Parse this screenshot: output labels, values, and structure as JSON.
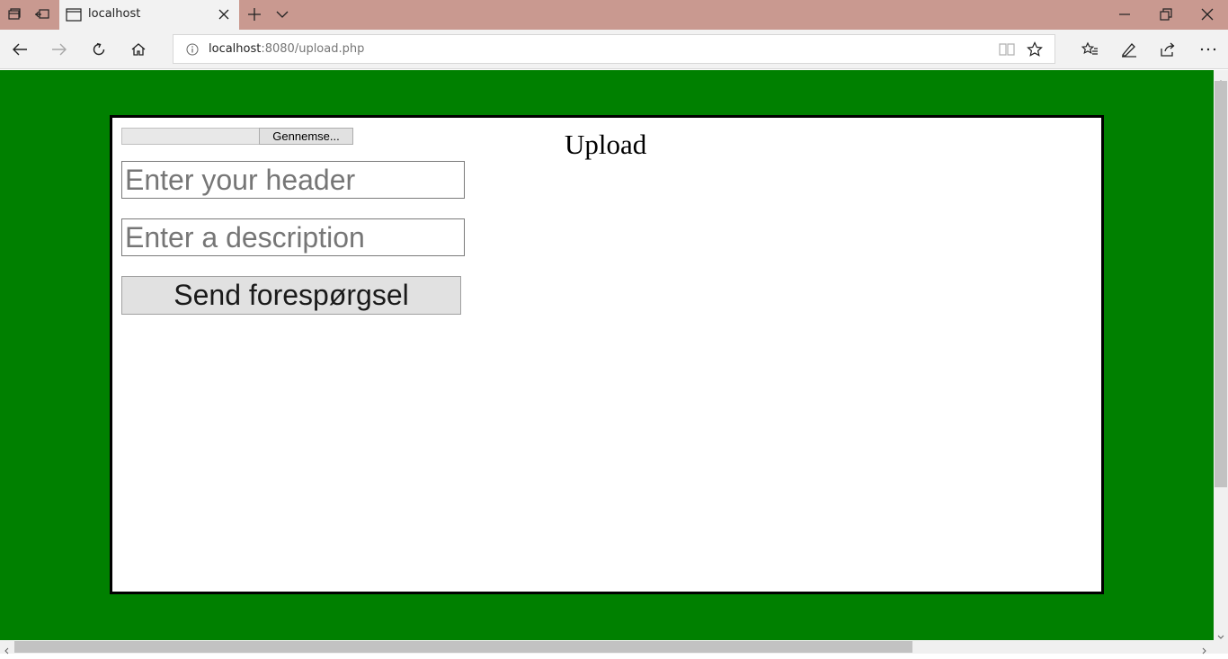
{
  "browser": {
    "tab_title": "localhost",
    "url_host": "localhost",
    "url_rest": ":8080/upload.php",
    "icons": [
      "tab-manager-icon",
      "set-aside-tabs-icon",
      "page-icon",
      "close-tab-icon",
      "new-tab-icon",
      "tab-preview-chevron-icon",
      "minimize-icon",
      "restore-icon",
      "close-window-icon",
      "back-icon",
      "forward-icon",
      "refresh-icon",
      "home-icon",
      "site-info-icon",
      "reading-view-icon",
      "favorite-star-icon",
      "favorites-hub-icon",
      "web-note-icon",
      "share-icon",
      "more-icon"
    ],
    "colors": {
      "titlebar": "#c99990",
      "toolbar": "#f2f2f2"
    }
  },
  "page": {
    "background_color": "#008000",
    "heading": "Upload",
    "file_button_label": "Gennemse...",
    "header_placeholder": "Enter your header",
    "description_placeholder": "Enter a description",
    "submit_label": "Send forespørgsel"
  }
}
